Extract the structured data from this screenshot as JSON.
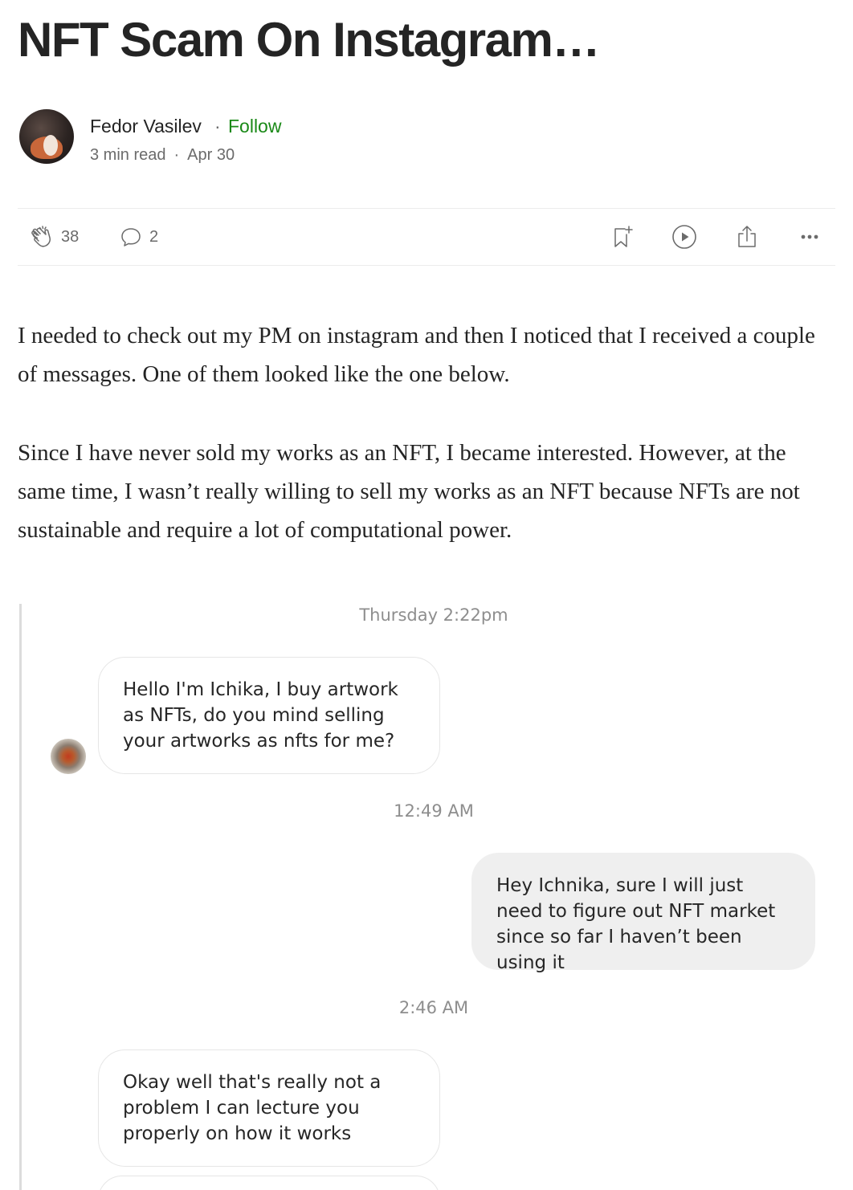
{
  "article": {
    "title": "NFT Scam On Instagram…",
    "author": {
      "name": "Fedor Vasilev",
      "separator": "·",
      "follow_label": "Follow",
      "read_time": "3 min read",
      "date": "Apr 30"
    },
    "actions": {
      "claps": "38",
      "responses": "2",
      "icons": [
        "clap-icon",
        "comment-icon",
        "bookmark-add-icon",
        "play-icon",
        "share-icon",
        "more-icon"
      ]
    },
    "paragraphs": [
      "I needed to check out my PM on instagram and then I noticed that I received a couple of messages. One of them looked like the one below.",
      "Since I have never sold my works as an NFT, I became interested. However, at the same time, I wasn’t really willing to sell my works as an NFT because NFTs are not sustainable and require a lot of computational power."
    ]
  },
  "chat": {
    "timestamps": [
      "Thursday 2:22pm",
      "12:49 AM",
      "2:46 AM"
    ],
    "messages": [
      {
        "direction": "incoming",
        "text": "Hello I'm Ichika, I buy artwork as NFTs, do you mind selling your artworks as nfts for me?"
      },
      {
        "direction": "outgoing",
        "text": "Hey Ichnika, sure I will just need to figure out NFT market since so far I haven’t been using it"
      },
      {
        "direction": "incoming",
        "text": "Okay well that's really not a problem I can lecture you properly on how it works"
      }
    ]
  },
  "colors": {
    "text": "#242424",
    "muted": "#6b6b6b",
    "follow": "#1a8917",
    "chat_timestamp": "#8e8e8e",
    "bubble_outgoing": "#efefef",
    "bubble_border": "#e6e6e6"
  }
}
